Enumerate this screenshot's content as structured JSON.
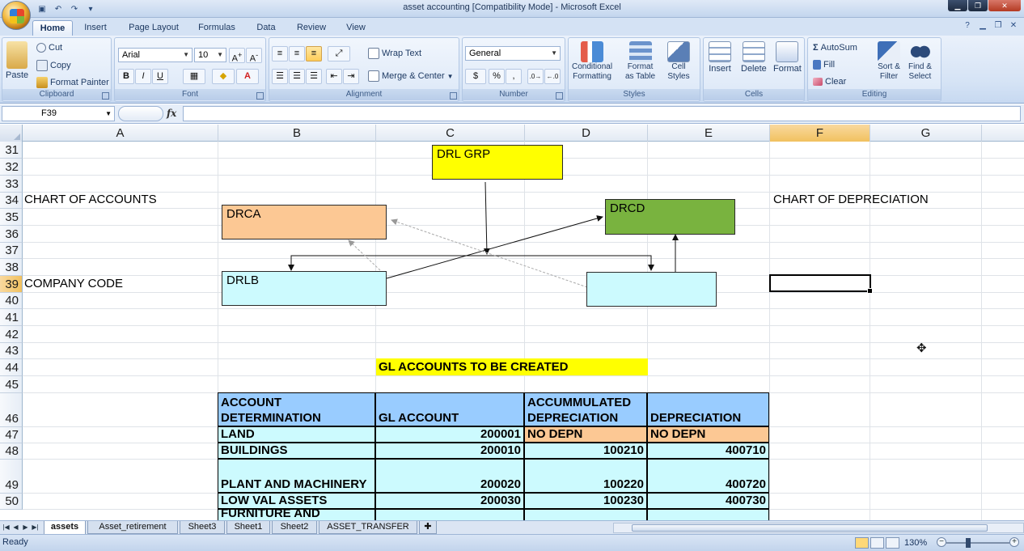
{
  "window": {
    "title": "asset accounting  [Compatibility Mode] - Microsoft Excel"
  },
  "ribbon": {
    "tabs": [
      "Home",
      "Insert",
      "Page Layout",
      "Formulas",
      "Data",
      "Review",
      "View"
    ],
    "active_tab": "Home",
    "clipboard": {
      "paste": "Paste",
      "cut": "Cut",
      "copy": "Copy",
      "format_painter": "Format Painter",
      "label": "Clipboard"
    },
    "font": {
      "name": "Arial",
      "size": "10",
      "label": "Font"
    },
    "alignment": {
      "wrap_text": "Wrap Text",
      "merge_center": "Merge & Center",
      "label": "Alignment"
    },
    "number": {
      "format": "General",
      "label": "Number"
    },
    "styles": {
      "conditional": "Conditional",
      "conditional2": "Formatting",
      "format_as": "Format",
      "format_as2": "as Table",
      "cell": "Cell",
      "cell2": "Styles",
      "label": "Styles"
    },
    "cells": {
      "insert": "Insert",
      "delete": "Delete",
      "format": "Format",
      "label": "Cells"
    },
    "editing": {
      "autosum": "AutoSum",
      "fill": "Fill",
      "clear": "Clear",
      "sort": "Sort &",
      "sort2": "Filter",
      "find": "Find &",
      "find2": "Select",
      "label": "Editing"
    }
  },
  "formula_bar": {
    "name_box": "F39",
    "fx": "fx",
    "formula": ""
  },
  "columns": [
    "A",
    "B",
    "C",
    "D",
    "E",
    "F",
    "G"
  ],
  "selected_column": "F",
  "rows": [
    "31",
    "32",
    "33",
    "34",
    "35",
    "36",
    "37",
    "38",
    "39",
    "40",
    "41",
    "42",
    "43",
    "44",
    "45",
    "46",
    "47",
    "48",
    "49",
    "50"
  ],
  "selected_row": "39",
  "cells": {
    "a34": "CHART OF ACCOUNTS",
    "a39": "COMPANY CODE",
    "f34": "CHART OF DEPRECIATION",
    "c44": "GL ACCOUNTS TO BE CREATED"
  },
  "diagram": {
    "drl_grp": "DRL GRP",
    "drca": "DRCA",
    "drcd": "DRCD",
    "drlb": "DRLB",
    "blank": "",
    "colors": {
      "yellow": "#ffff00",
      "orange": "#fcc894",
      "green": "#79b33f",
      "cyan": "#ccfafe"
    }
  },
  "table": {
    "header": {
      "col1a": "ACCOUNT",
      "col1b": "DETERMINATION",
      "col2": "GL ACCOUNT",
      "col3a": "ACCUMMULATED",
      "col3b": "DEPRECIATION",
      "col4": "DEPRECIATION"
    },
    "rows": [
      {
        "name": "LAND",
        "gl": "200001",
        "accum": "NO DEPN",
        "depr": "NO DEPN"
      },
      {
        "name": "BUILDINGS",
        "gl": "200010",
        "accum": "100210",
        "depr": "400710"
      },
      {
        "name": "PLANT AND MACHINERY",
        "gl": "200020",
        "accum": "100220",
        "depr": "400720"
      },
      {
        "name": "LOW VAL ASSETS",
        "gl": "200030",
        "accum": "100230",
        "depr": "400730"
      },
      {
        "name": "FURNITURE AND",
        "gl": "",
        "accum": "",
        "depr": ""
      }
    ]
  },
  "sheets": [
    "assets",
    "Asset_retirement",
    "Sheet3",
    "Sheet1",
    "Sheet2",
    "ASSET_TRANSFER"
  ],
  "active_sheet": "assets",
  "status": {
    "ready": "Ready",
    "zoom": "130%"
  }
}
